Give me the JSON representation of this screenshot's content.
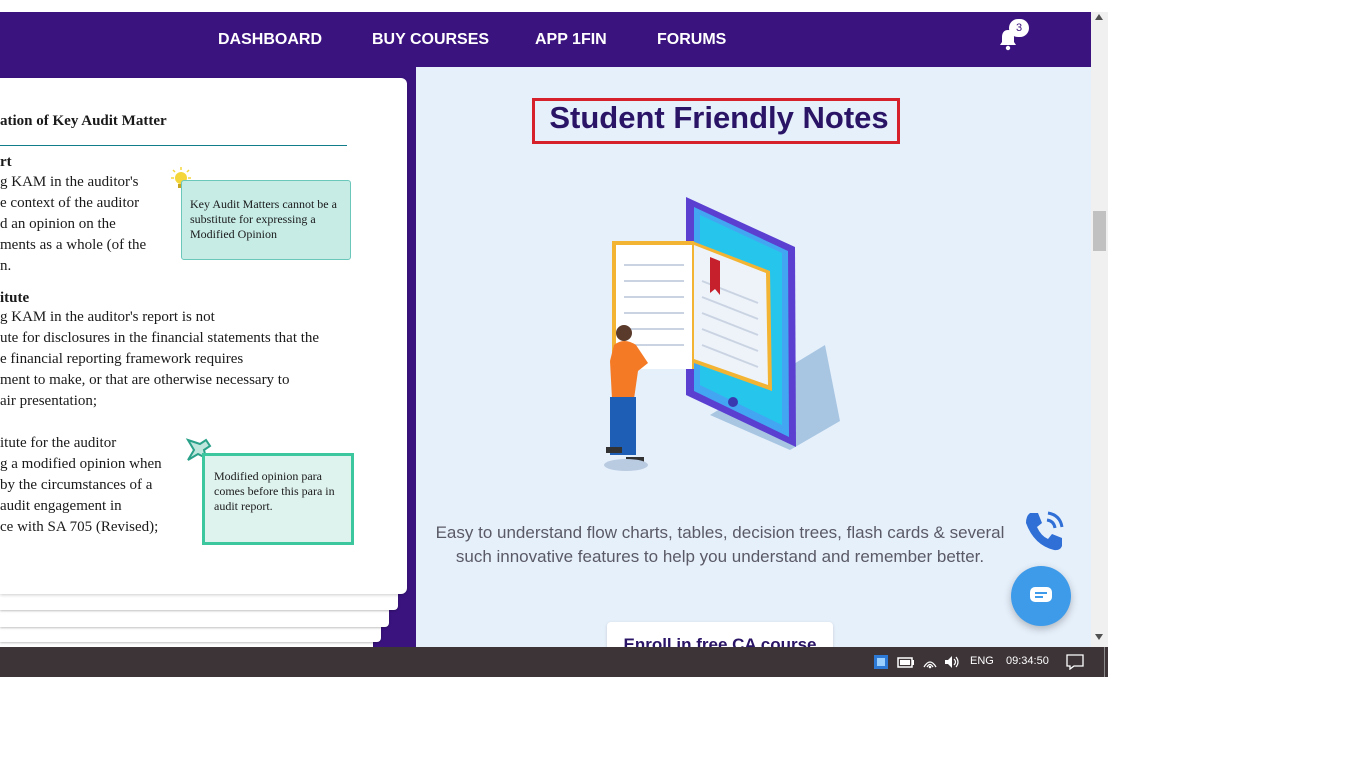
{
  "nav": {
    "links": [
      "DASHBOARD",
      "BUY COURSES",
      "APP 1FIN",
      "FORUMS"
    ],
    "notification_count": "3"
  },
  "book": {
    "heading": "ation of Key Audit Matter",
    "section1_heading": "rt",
    "section1_lines": [
      "g KAM in the auditor's",
      "e context of the auditor",
      "d an opinion on the",
      "ments as a whole (of the",
      "n."
    ],
    "callout1": "Key Audit Matters cannot be a substitute for expressing a Modified Opinion",
    "section2_heading": "itute",
    "section2_lines": [
      "g KAM in the auditor's report is not",
      "ute for disclosures in the financial statements that the",
      "e financial reporting framework requires",
      "ment to make, or that are otherwise necessary to",
      "air presentation;"
    ],
    "section3_lines": [
      "itute for the auditor",
      "g a modified opinion when",
      "by the circumstances of a",
      "audit engagement in",
      "ce with SA 705 (Revised);"
    ],
    "callout2": "Modified opinion para comes before this para in audit report."
  },
  "main": {
    "title": "Student Friendly Notes",
    "description": "Easy to understand flow charts, tables, decision trees, flash cards & several such innovative features to help you understand and remember better.",
    "enroll_label": "Enroll in free CA course"
  },
  "taskbar": {
    "language": "ENG",
    "time": "09:34:50"
  },
  "colors": {
    "nav_bg": "#3a137f",
    "content_bg": "#e6f0fb",
    "title_text": "#2a1466",
    "highlight_border": "#d6202a",
    "chat_button": "#3e9bea",
    "taskbar_bg": "#3d3437",
    "book_teal": "#127c8a"
  },
  "icons": [
    "bell-icon",
    "phone-icon",
    "chat-icon",
    "scroll-up-icon",
    "scroll-down-icon",
    "windows-defender-icon",
    "battery-icon",
    "wifi-icon",
    "volume-icon",
    "notification-center-icon"
  ]
}
